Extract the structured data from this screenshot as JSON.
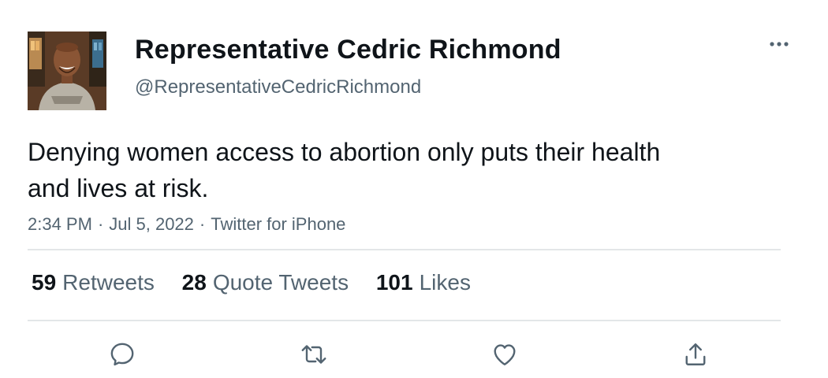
{
  "tweet": {
    "display_name": "Representative Cedric Richmond",
    "handle": "@RepresentativeCedricRichmond",
    "text": "Denying women access to abortion only puts their health and lives at risk.",
    "time": "2:34 PM",
    "date": "Jul 5, 2022",
    "source": "Twitter for iPhone",
    "separator": "·"
  },
  "stats": {
    "retweets_count": "59",
    "retweets_label": "Retweets",
    "quotes_count": "28",
    "quotes_label": "Quote Tweets",
    "likes_count": "101",
    "likes_label": "Likes"
  },
  "icons": {
    "more": "more-icon",
    "reply": "reply-icon",
    "retweet": "retweet-icon",
    "like": "like-icon",
    "share": "share-icon"
  },
  "colors": {
    "text_primary": "#0f1419",
    "text_secondary": "#536471",
    "divider": "#e3e6e8"
  }
}
